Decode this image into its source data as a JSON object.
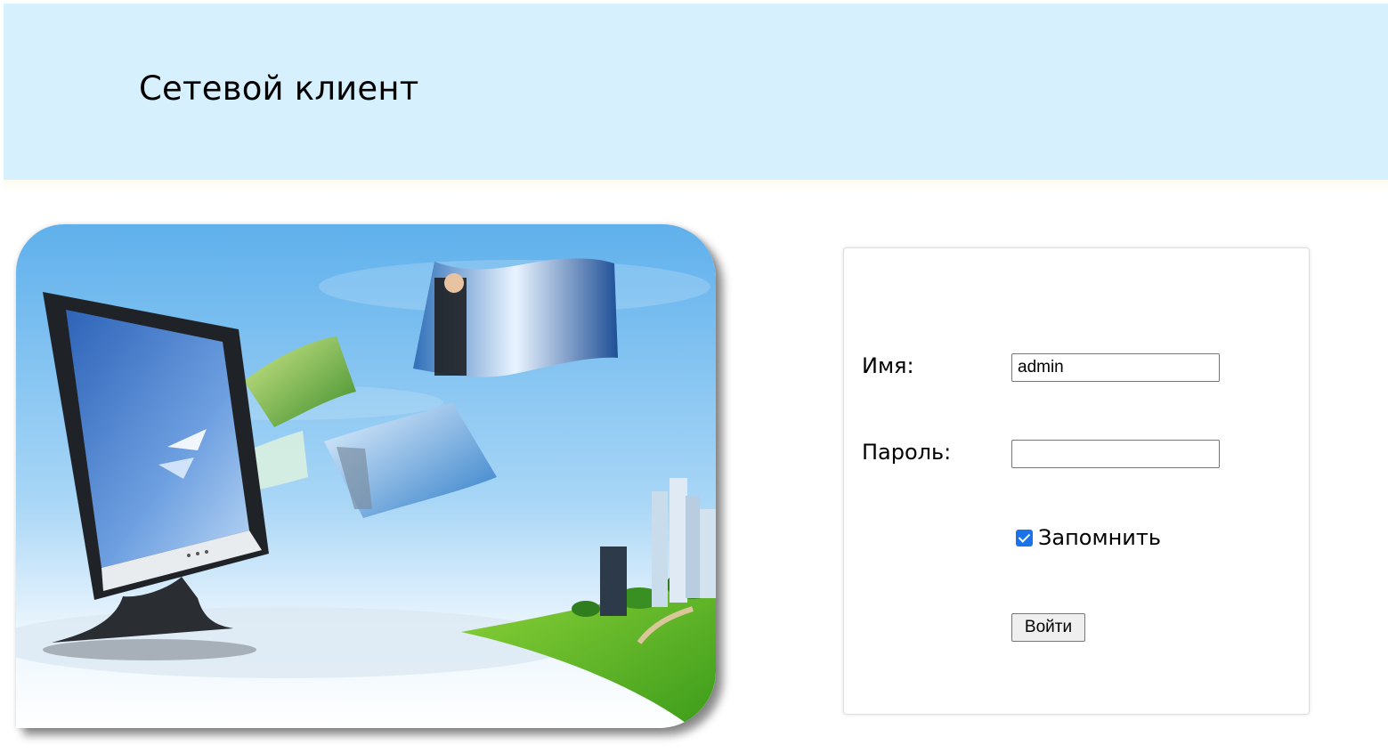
{
  "header": {
    "title": "Сетевой клиент",
    "background_color": "#d6f1fd"
  },
  "illustration": {
    "icon": "computer-monitor-with-flying-photos-illustration"
  },
  "login_form": {
    "username_label": "Имя:",
    "username_value": "admin",
    "password_label": "Пароль:",
    "password_value": "",
    "remember_label": "Запомнить",
    "remember_checked": true,
    "submit_label": "Войти",
    "accent_color": "#1a73e8"
  }
}
